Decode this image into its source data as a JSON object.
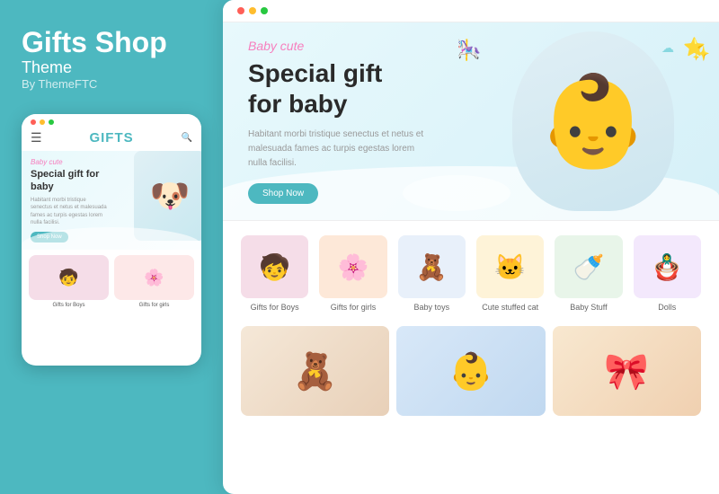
{
  "left_panel": {
    "title": "Gifts Shop",
    "subtitle": "Theme",
    "by_line": "By ThemeFTC"
  },
  "mobile_mockup": {
    "dots": [
      "red",
      "yellow",
      "green"
    ],
    "logo": "GIFTS",
    "hero_tag": "Baby cute",
    "hero_title": "Special gift for baby",
    "hero_desc": "Habitant morbi tristique senectus et netus et malesuada fames ac turpis egestas lorem nulla facilisi.",
    "shop_btn": "Shop Now",
    "products": [
      {
        "label": "Gifts for Boys",
        "emoji": "🧒"
      },
      {
        "label": "Gifts for girls",
        "emoji": "🌸"
      }
    ]
  },
  "desktop": {
    "hero_tag": "Baby cute",
    "hero_title": "Special gift\nfor baby",
    "hero_desc": "Habitant morbi tristique senectus et netus et malesuada fames ac turpis egestas lorem nulla facilisi.",
    "shop_btn": "Shop Now",
    "products": [
      {
        "label": "Gifts for Boys",
        "emoji": "🧒",
        "bg": "product-img-1"
      },
      {
        "label": "Gifts for girls",
        "emoji": "🌸",
        "bg": "product-img-2"
      },
      {
        "label": "Baby toys",
        "emoji": "🧸",
        "bg": "product-img-3"
      },
      {
        "label": "Cute stuffed cat",
        "emoji": "🐱",
        "bg": "product-img-4"
      },
      {
        "label": "Baby Stuff",
        "emoji": "🍼",
        "bg": "product-img-5"
      },
      {
        "label": "Dolls",
        "emoji": "🪆",
        "bg": "product-img-6"
      }
    ]
  },
  "colors": {
    "teal": "#4db8c0",
    "pink": "#f77fbe",
    "white": "#ffffff"
  }
}
